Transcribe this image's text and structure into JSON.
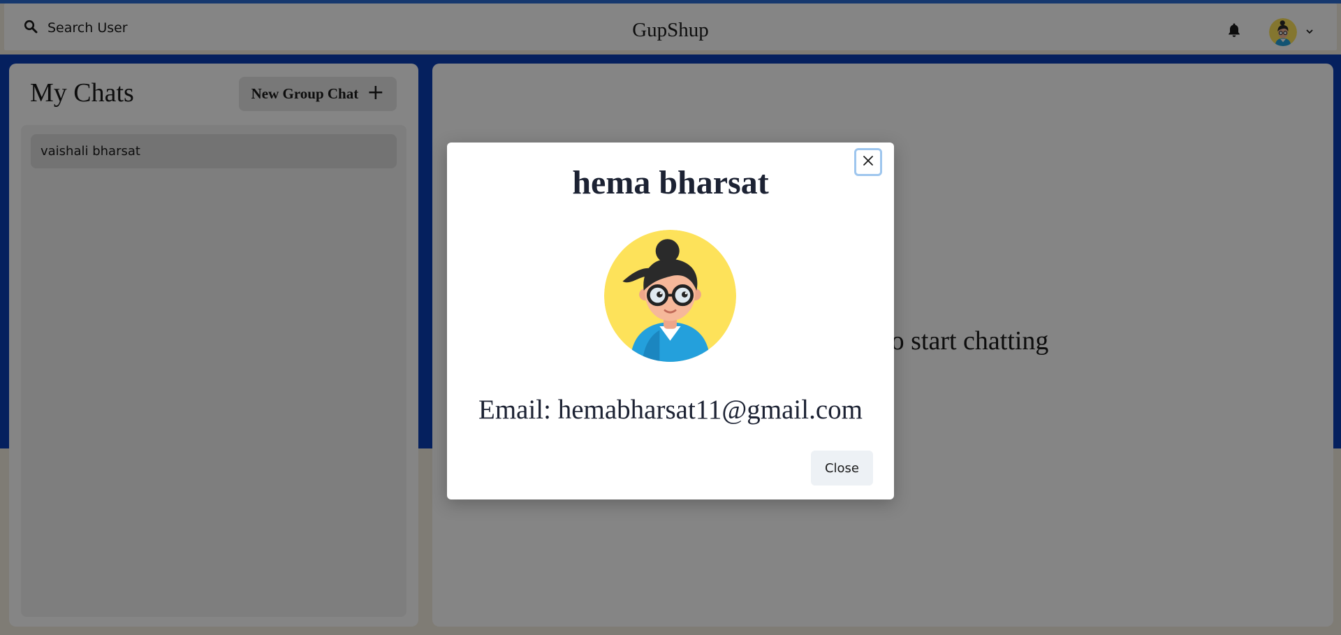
{
  "header": {
    "search_label": "Search User",
    "brand": "GupShup"
  },
  "sidebar": {
    "title": "My Chats",
    "new_group_label": "New Group Chat",
    "new_group_icon": "+",
    "chats": [
      {
        "name": "vaishali bharsat"
      }
    ]
  },
  "main": {
    "placeholder": "Click on a user to start chatting"
  },
  "modal": {
    "title": "hema bharsat",
    "email_line": "Email: hemabharsat11@gmail.com",
    "close_label": "Close"
  },
  "icons": {
    "search": "search-icon",
    "bell": "bell-icon",
    "chevron": "chevron-down-icon",
    "close": "close-icon",
    "avatar": "avatar"
  },
  "colors": {
    "top_accent": "#2b6cd4",
    "app_blue": "#0b3fb5",
    "focus_ring": "#9ec6ee",
    "avatar_bg": "#fde25a",
    "shirt": "#24a0dc"
  }
}
